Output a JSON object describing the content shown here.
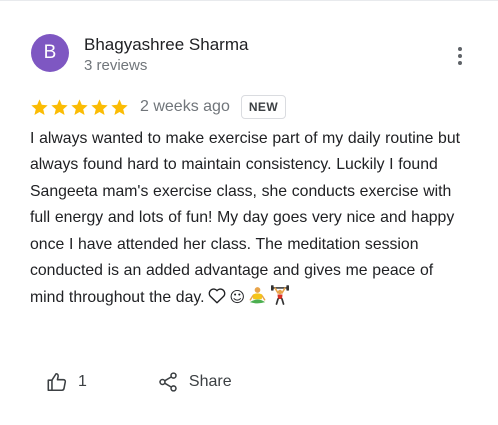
{
  "reviewer": {
    "initial": "B",
    "name": "Bhagyashree Sharma",
    "review_count": "3 reviews",
    "avatar_color": "#7e57c2"
  },
  "rating": {
    "stars": 5,
    "max_stars": 5,
    "star_color": "#fbbc04",
    "time_ago": "2 weeks ago",
    "badge": "NEW"
  },
  "review": {
    "text": "I always wanted to make exercise part of my daily routine but always found hard to maintain consistency. Luckily I found Sangeeta mam's exercise class, she conducts exercise with full energy and lots of fun! My day goes very nice and happy once I have attended her class. The meditation session conducted is an added advantage and gives me peace of mind throughout the day.",
    "emojis": [
      "heart-outline",
      "smiley",
      "person-in-lotus-position",
      "person-lifting-weights"
    ]
  },
  "actions": {
    "like_count": "1",
    "share_label": "Share",
    "like_icon": "thumbs-up-icon",
    "share_icon": "share-icon"
  },
  "menu": {
    "icon": "more-vert-icon"
  }
}
